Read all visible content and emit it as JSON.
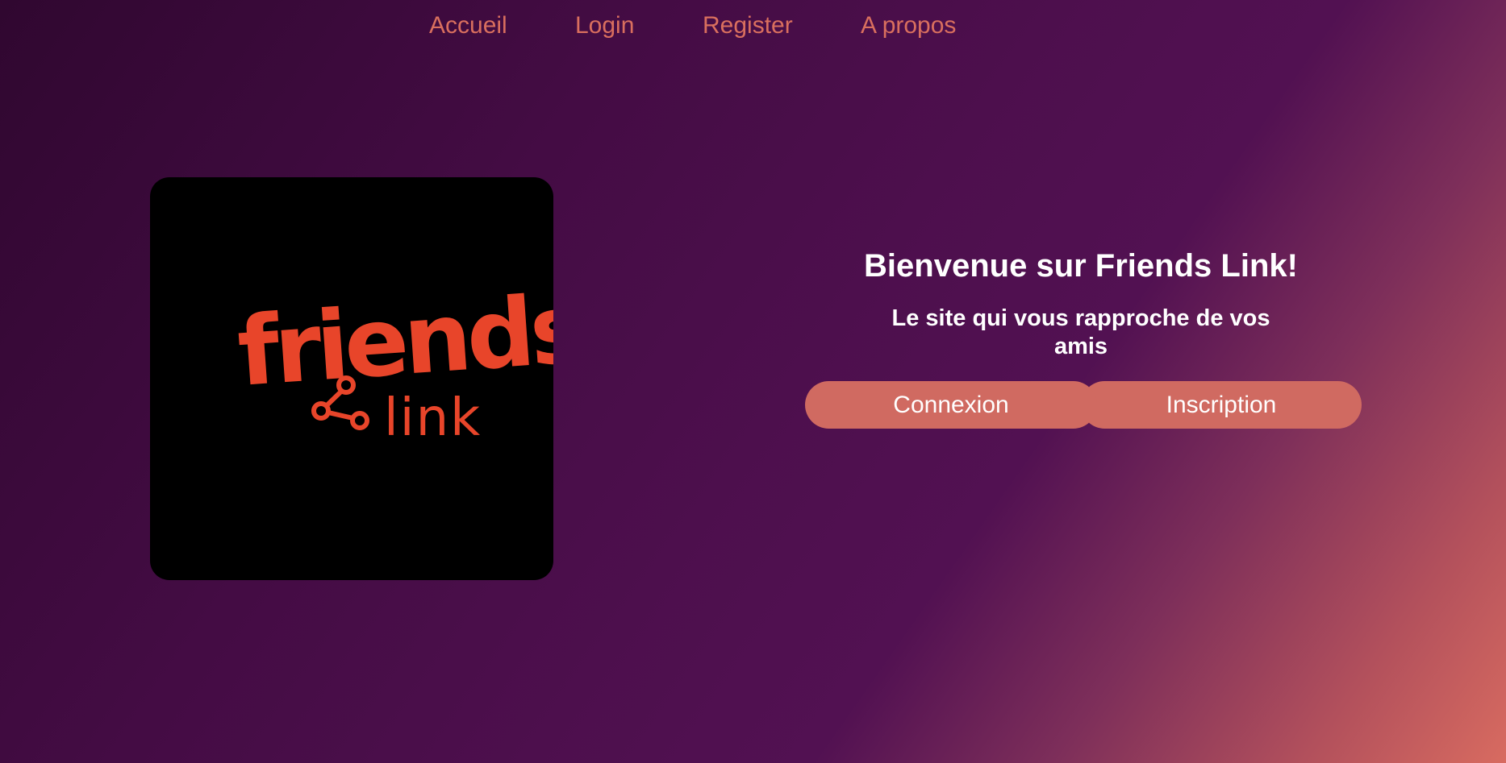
{
  "nav": {
    "links": [
      "Accueil",
      "Login",
      "Register",
      "A propos"
    ]
  },
  "logo": {
    "word_top": "friends",
    "word_bottom": "link",
    "icon": "share-icon"
  },
  "hero": {
    "title": "Bienvenue sur Friends Link!",
    "subtitle": "Le site qui vous rapproche de vos amis",
    "buttons": {
      "login_label": "Connexion",
      "register_label": "Inscription"
    }
  },
  "colors": {
    "accent": "#d06a61",
    "nav_link": "#d96f5e",
    "logo_orange": "#e8452a",
    "logo_background": "#000000",
    "background_dark": "#300730",
    "background_mid": "#521152",
    "background_corner": "#d86b60"
  }
}
